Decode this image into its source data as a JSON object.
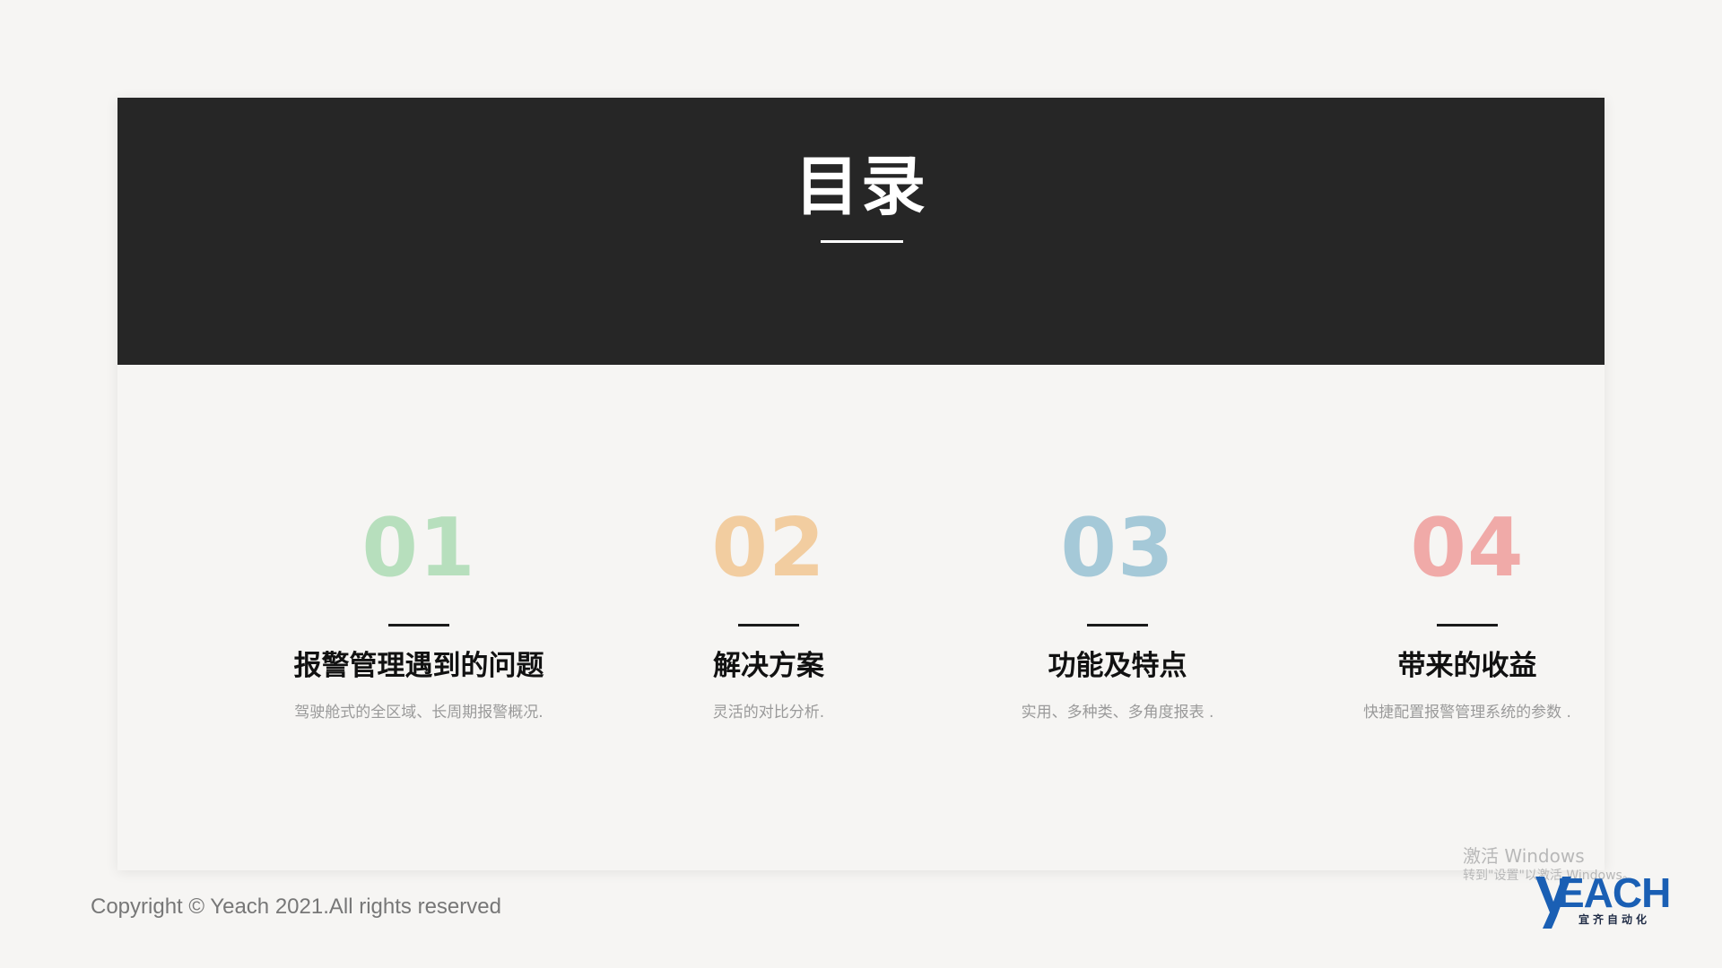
{
  "header": {
    "title": "目录"
  },
  "items": [
    {
      "number": "01",
      "title": "报警管理遇到的问题",
      "desc": "驾驶舱式的全区域、长周期报警概况.",
      "color": "#b7dfbd"
    },
    {
      "number": "02",
      "title": "解决方案",
      "desc": "灵活的对比分析.",
      "color": "#f2cda0"
    },
    {
      "number": "03",
      "title": "功能及特点",
      "desc": "实用、多种类、多角度报表 .",
      "color": "#a5c9d8"
    },
    {
      "number": "04",
      "title": "带来的收益",
      "desc": "快捷配置报警管理系统的参数 .",
      "color": "#f0aaa8"
    }
  ],
  "footer": {
    "copyright": "Copyright © Yeach 2021.All rights reserved"
  },
  "watermark": {
    "line1": "激活 Windows",
    "line2": "转到\"设置\"以激活 Windows。"
  },
  "logo": {
    "text": "EACH",
    "subtext": "宜齐自动化",
    "color": "#1a5fb4"
  }
}
